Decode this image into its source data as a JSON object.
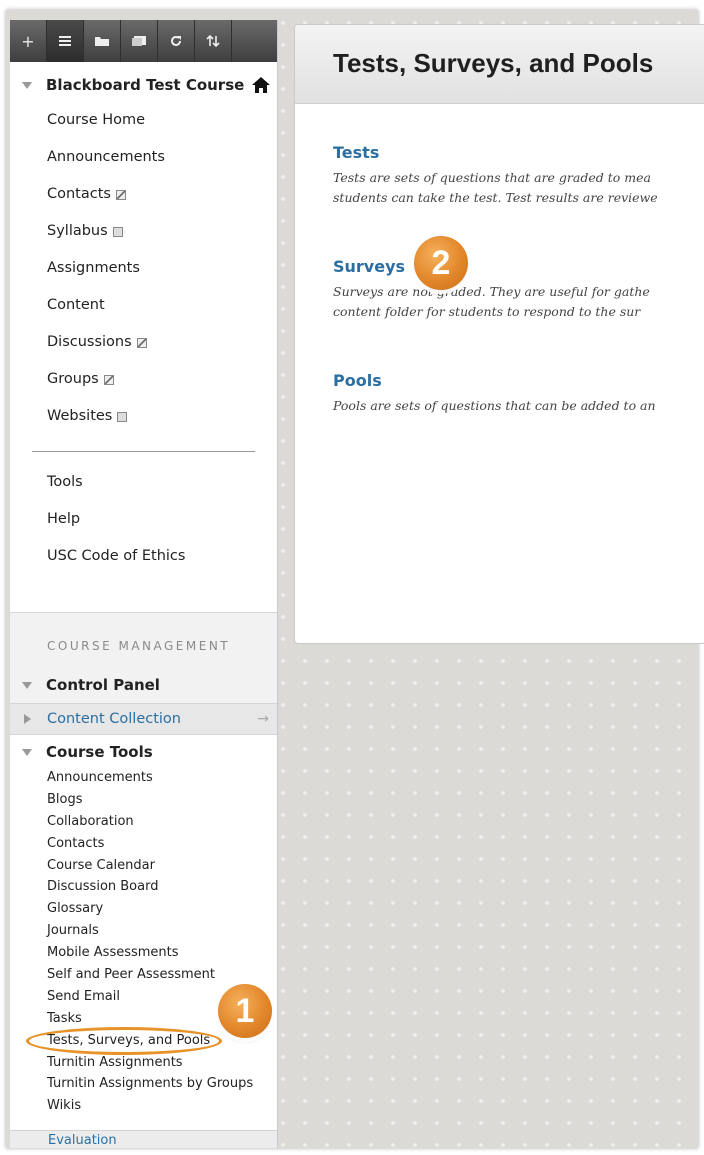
{
  "toolbar": {
    "buttons": [
      "+",
      "list-icon",
      "folder-icon",
      "window-icon",
      "refresh-icon",
      "sort-icon"
    ]
  },
  "course": {
    "title": "Blackboard Test Course",
    "menu": [
      {
        "label": "Course Home",
        "icon": null
      },
      {
        "label": "Announcements",
        "icon": null
      },
      {
        "label": "Contacts",
        "icon": "hidden-slash-icon"
      },
      {
        "label": "Syllabus",
        "icon": "empty-box-icon"
      },
      {
        "label": "Assignments",
        "icon": null
      },
      {
        "label": "Content",
        "icon": null
      },
      {
        "label": "Discussions",
        "icon": "hidden-slash-icon"
      },
      {
        "label": "Groups",
        "icon": "hidden-slash-icon"
      },
      {
        "label": "Websites",
        "icon": "empty-box-icon"
      }
    ],
    "menu2": [
      "Tools",
      "Help",
      "USC Code of Ethics"
    ]
  },
  "management": {
    "label": "COURSE MANAGEMENT",
    "control_panel": "Control Panel",
    "content_collection": "Content Collection",
    "course_tools": "Course Tools",
    "tools": [
      "Announcements",
      "Blogs",
      "Collaboration",
      "Contacts",
      "Course Calendar",
      "Discussion Board",
      "Glossary",
      "Journals",
      "Mobile Assessments",
      "Self and Peer Assessment",
      "Send Email",
      "Tasks",
      "Tests, Surveys, and Pools",
      "Turnitin Assignments",
      "Turnitin Assignments by Groups",
      "Wikis"
    ],
    "evaluation": "Evaluation"
  },
  "page": {
    "title": "Tests, Surveys, and Pools",
    "sections": [
      {
        "title": "Tests",
        "lines": [
          "Tests are sets of questions that are graded to mea",
          "students can take the test. Test results are reviewe"
        ]
      },
      {
        "title": "Surveys",
        "lines": [
          "Surveys are not graded. They are useful for gathe",
          "content folder for students to respond to the sur"
        ]
      },
      {
        "title": "Pools",
        "lines": [
          "Pools are sets of questions that can be added to an"
        ]
      }
    ]
  },
  "callouts": {
    "badge1": "1",
    "badge2": "2"
  },
  "colors": {
    "accent_link": "#2b6fa2",
    "callout_orange": "#e8932a",
    "toolbar_dark": "#3e3e3e"
  }
}
